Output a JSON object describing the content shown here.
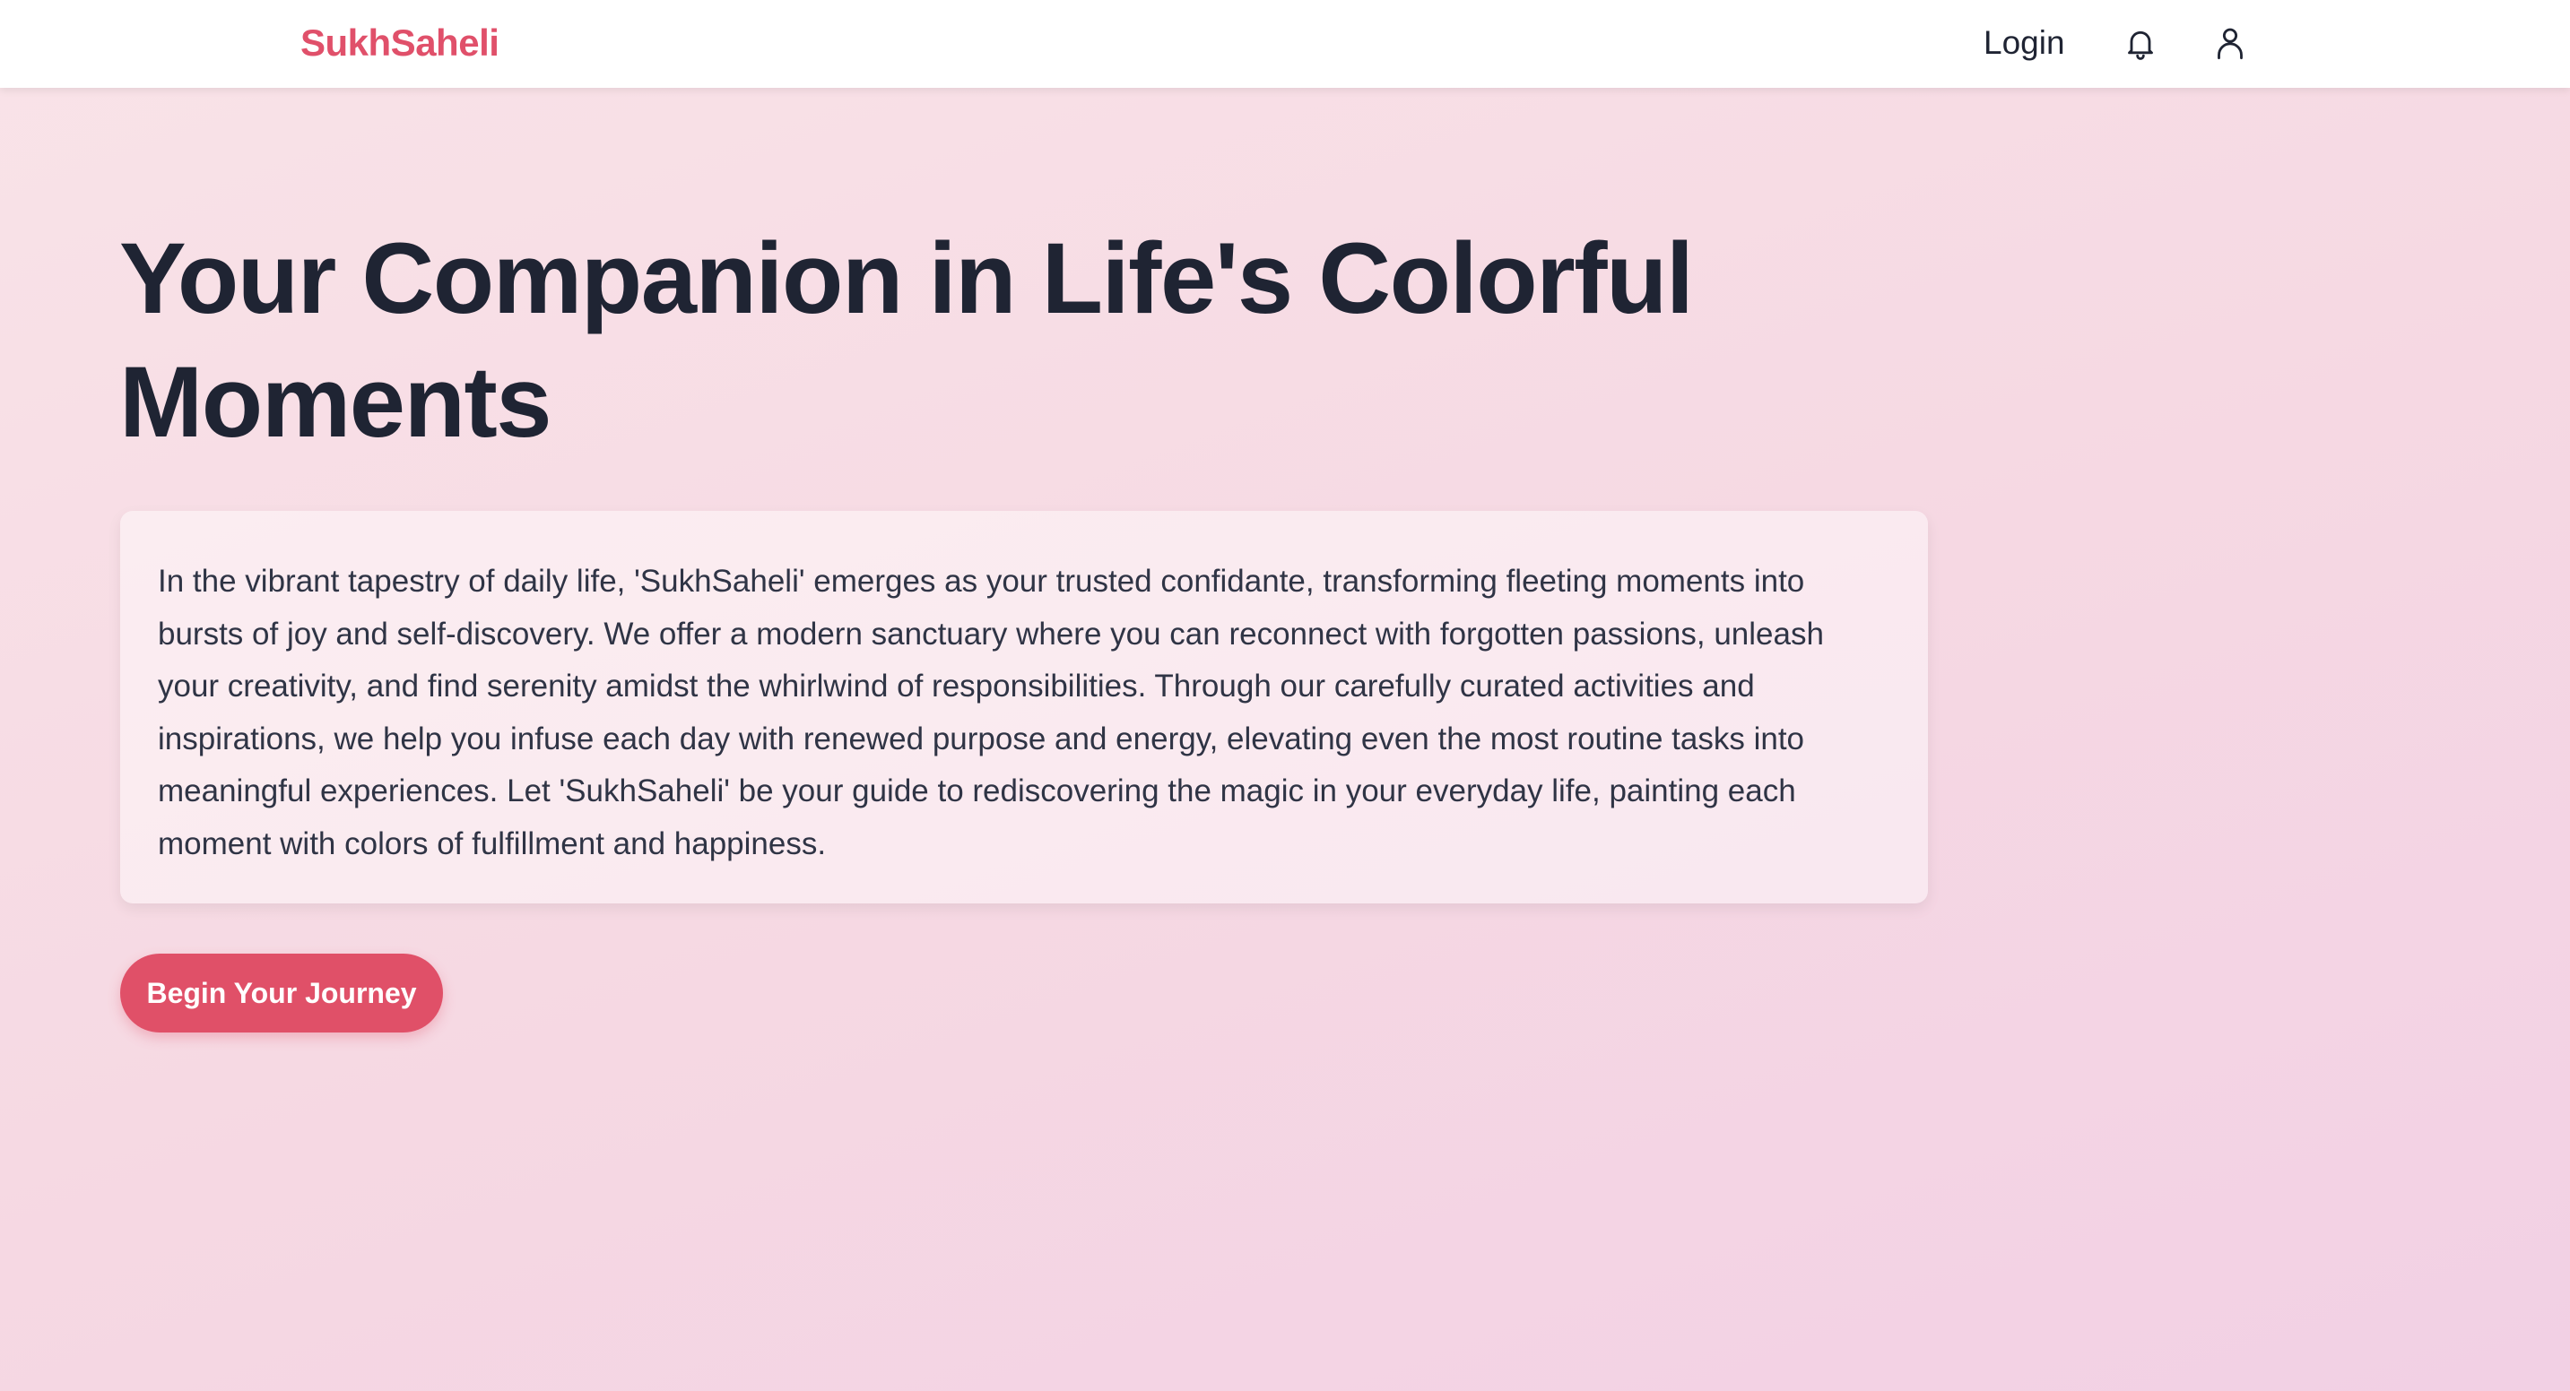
{
  "header": {
    "brand": "SukhSaheli",
    "login_label": "Login",
    "icons": [
      "bell-icon",
      "user-icon"
    ]
  },
  "hero": {
    "title": "Your Companion in Life's Colorful Moments",
    "description": "In the vibrant tapestry of daily life, 'SukhSaheli' emerges as your trusted confidante, transforming fleeting moments into bursts of joy and self-discovery. We offer a modern sanctuary where you can reconnect with forgotten passions, unleash your creativity, and find serenity amidst the whirlwind of responsibilities. Through our carefully curated activities and inspirations, we help you infuse each day with renewed purpose and energy, elevating even the most routine tasks into meaningful experiences. Let 'SukhSaheli' be your guide to rediscovering the magic in your everyday life, painting each moment with colors of fulfillment and happiness.",
    "cta_label": "Begin Your Journey"
  },
  "colors": {
    "brand": "#e0506a",
    "cta_background": "#e05068",
    "heading_text": "#1f2433",
    "body_text": "#2f3445",
    "background_start": "#f9e3e8",
    "background_end": "#f2d0e4"
  }
}
